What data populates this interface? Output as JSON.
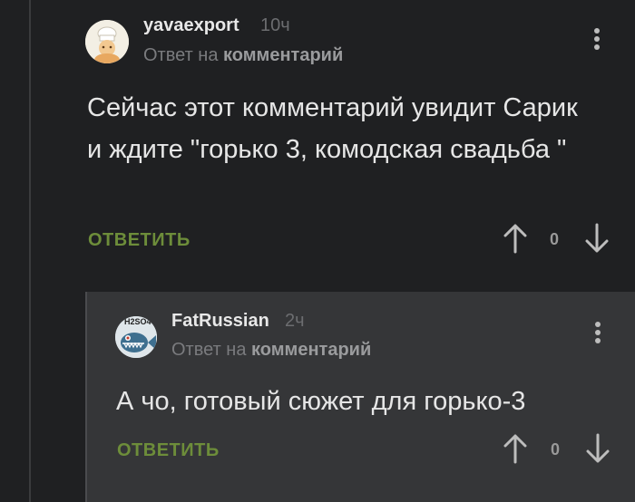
{
  "comment1": {
    "username": "yavaexport",
    "time": "10ч",
    "reply_prefix": "Ответ на",
    "reply_target": "комментарий",
    "text": "Сейчас этот комментарий увидит Сарик и ждите \"горько 3, комодская свадьба \"",
    "reply_label": "ОТВЕТИТЬ",
    "votes": "0"
  },
  "comment2": {
    "username": "FatRussian",
    "time": "2ч",
    "reply_prefix": "Ответ на",
    "reply_target": "комментарий",
    "text": "А чо, готовый сюжет для горько-3",
    "reply_label": "ОТВЕТИТЬ",
    "votes": "0",
    "avatar_text": "H2SO4"
  },
  "colors": {
    "background": "#1f2022",
    "nested_background": "#353638",
    "reply_green": "#6d8d3a"
  }
}
